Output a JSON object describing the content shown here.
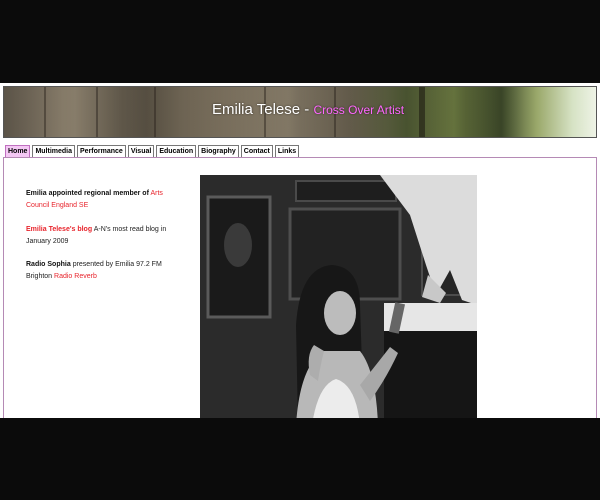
{
  "header": {
    "title": "Emilia Telese",
    "separator": "-",
    "subtitle": "Cross Over Artist"
  },
  "nav": {
    "tabs": [
      {
        "label": "Home",
        "active": true
      },
      {
        "label": "Multimedia",
        "active": false
      },
      {
        "label": "Performance",
        "active": false
      },
      {
        "label": "Visual",
        "active": false
      },
      {
        "label": "Education",
        "active": false
      },
      {
        "label": "Biography",
        "active": false
      },
      {
        "label": "Contact",
        "active": false
      },
      {
        "label": "Links",
        "active": false
      }
    ]
  },
  "news": {
    "item1": {
      "text": "Emilia appointed regional member of",
      "link": "Arts Council England SE"
    },
    "item2": {
      "link": "Emilia Telese's blog",
      "text": "A-N's most read blog in January 2009"
    },
    "item3": {
      "bold": "Radio Sophia",
      "text": "presented by Emilia 97.2 FM Brighton",
      "link": "Radio Reverb"
    }
  },
  "colors": {
    "link": "#e8242c",
    "subtitle": "#ff66ff",
    "active_tab": "#f4c8f4",
    "content_border": "#b58ab5"
  }
}
